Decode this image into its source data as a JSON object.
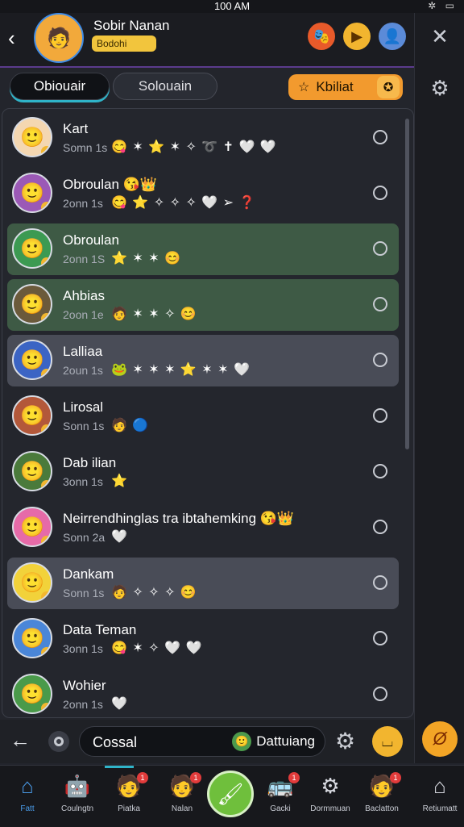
{
  "status": {
    "time": "100 AM"
  },
  "header": {
    "title": "Sobir Nanan",
    "badge": "Bodohi",
    "back_icon": "chevron-left-icon",
    "avatar_icon": "user-avatar-icon",
    "icons": [
      "mask-face-icon",
      "play-icon",
      "profile-icon"
    ]
  },
  "tabs": {
    "active": "Obiouair",
    "second": "Solouain",
    "special": "Kbiliat"
  },
  "contacts": [
    {
      "name": "Kart",
      "time": "Somn 1s",
      "icons": "😋 ✶ ⭐ ✶ ✧ ➰ ✝ 🤍 🤍",
      "style": "plain",
      "face": "🙂",
      "bg": "#f4d7b1"
    },
    {
      "name": "Obroulan 😘👑",
      "time": "2onn 1s",
      "icons": "😋 ⭐ ✧ ✧ ✧ 🤍 ➢ ❓",
      "style": "plain",
      "face": "🙂",
      "bg": "#9b59b6"
    },
    {
      "name": "Obroulan",
      "time": "2onn 1S",
      "icons": "⭐ ✶ ✶ 😊",
      "style": "green",
      "face": "🙂",
      "bg": "#3c9a52"
    },
    {
      "name": "Ahbias",
      "time": "2oon 1e",
      "icons": "🧑 ✶ ✶ ✧ 😊",
      "style": "green",
      "face": "🙂",
      "bg": "#6b5a3b"
    },
    {
      "name": "Lalliaa",
      "time": "2oun 1s",
      "icons": "🐸 ✶ ✶ ✶ ⭐ ✶ ✶ 🤍",
      "style": "grey",
      "face": "🙂",
      "bg": "#3b64c4"
    },
    {
      "name": "Lirosal",
      "time": "Sonn 1s",
      "icons": "🧑 🔵",
      "style": "plain",
      "face": "🙂",
      "bg": "#b3583a"
    },
    {
      "name": "Dab ilian",
      "time": "3onn 1s",
      "icons": "⭐",
      "style": "plain",
      "face": "🙂",
      "bg": "#4a7a3b"
    },
    {
      "name": "Neirrendhinglas tra ibtahemking 😘👑",
      "time": "Sonn 2a",
      "icons": "🤍",
      "style": "plain",
      "face": "🙂",
      "bg": "#e66aa8"
    },
    {
      "name": "Dankam",
      "time": "Sonn 1s",
      "icons": "🧑 ✧ ✧ ✧ 😊",
      "style": "grey",
      "face": "🙂",
      "bg": "#f2d23a"
    },
    {
      "name": "Data Teman",
      "time": "3onn 1s",
      "icons": "😋 ✶ ✧ 🤍 🤍",
      "style": "plain",
      "face": "🙂",
      "bg": "#4a86d8"
    },
    {
      "name": "Wohier",
      "time": "2onn 1s",
      "icons": "🤍",
      "style": "plain",
      "face": "🙂",
      "bg": "#4a9a4a"
    }
  ],
  "composer": {
    "value": "Cossal",
    "chip": "Dattuiang"
  },
  "nav": [
    {
      "label": "Fatt",
      "icon": "home-icon",
      "badge": ""
    },
    {
      "label": "Coulngtn",
      "icon": "robot-icon",
      "badge": ""
    },
    {
      "label": "Piatka",
      "icon": "avatar-icon",
      "badge": "1"
    },
    {
      "label": "Nalan",
      "icon": "avatar-icon",
      "badge": "1"
    },
    {
      "label": "Gacki",
      "icon": "bus-icon",
      "badge": "1"
    },
    {
      "label": "Dormmuan",
      "icon": "gear-icon",
      "badge": ""
    },
    {
      "label": "Baclatton",
      "icon": "avatar-icon",
      "badge": "1"
    },
    {
      "label": "Retiumatt",
      "icon": "home-icon",
      "badge": ""
    }
  ]
}
